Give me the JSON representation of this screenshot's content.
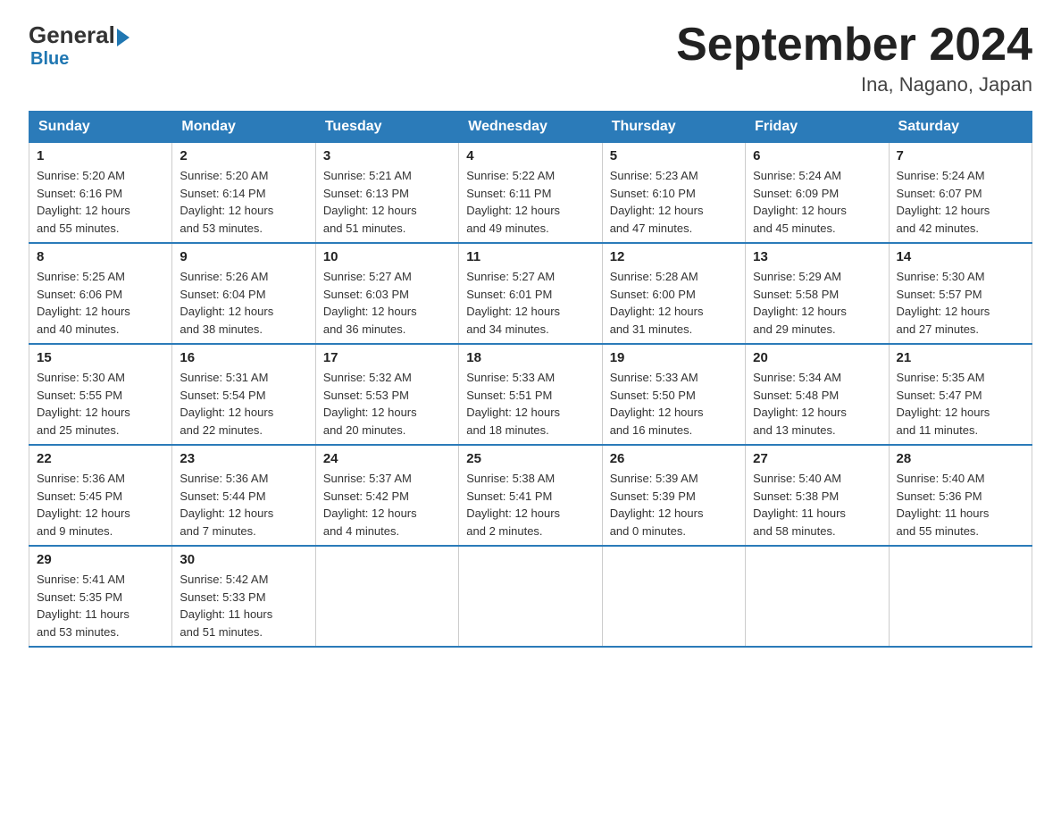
{
  "logo": {
    "general": "General",
    "blue": "Blue"
  },
  "header": {
    "month_year": "September 2024",
    "location": "Ina, Nagano, Japan"
  },
  "days_of_week": [
    "Sunday",
    "Monday",
    "Tuesday",
    "Wednesday",
    "Thursday",
    "Friday",
    "Saturday"
  ],
  "weeks": [
    [
      {
        "day": "1",
        "sunrise": "5:20 AM",
        "sunset": "6:16 PM",
        "daylight": "12 hours and 55 minutes."
      },
      {
        "day": "2",
        "sunrise": "5:20 AM",
        "sunset": "6:14 PM",
        "daylight": "12 hours and 53 minutes."
      },
      {
        "day": "3",
        "sunrise": "5:21 AM",
        "sunset": "6:13 PM",
        "daylight": "12 hours and 51 minutes."
      },
      {
        "day": "4",
        "sunrise": "5:22 AM",
        "sunset": "6:11 PM",
        "daylight": "12 hours and 49 minutes."
      },
      {
        "day": "5",
        "sunrise": "5:23 AM",
        "sunset": "6:10 PM",
        "daylight": "12 hours and 47 minutes."
      },
      {
        "day": "6",
        "sunrise": "5:24 AM",
        "sunset": "6:09 PM",
        "daylight": "12 hours and 45 minutes."
      },
      {
        "day": "7",
        "sunrise": "5:24 AM",
        "sunset": "6:07 PM",
        "daylight": "12 hours and 42 minutes."
      }
    ],
    [
      {
        "day": "8",
        "sunrise": "5:25 AM",
        "sunset": "6:06 PM",
        "daylight": "12 hours and 40 minutes."
      },
      {
        "day": "9",
        "sunrise": "5:26 AM",
        "sunset": "6:04 PM",
        "daylight": "12 hours and 38 minutes."
      },
      {
        "day": "10",
        "sunrise": "5:27 AM",
        "sunset": "6:03 PM",
        "daylight": "12 hours and 36 minutes."
      },
      {
        "day": "11",
        "sunrise": "5:27 AM",
        "sunset": "6:01 PM",
        "daylight": "12 hours and 34 minutes."
      },
      {
        "day": "12",
        "sunrise": "5:28 AM",
        "sunset": "6:00 PM",
        "daylight": "12 hours and 31 minutes."
      },
      {
        "day": "13",
        "sunrise": "5:29 AM",
        "sunset": "5:58 PM",
        "daylight": "12 hours and 29 minutes."
      },
      {
        "day": "14",
        "sunrise": "5:30 AM",
        "sunset": "5:57 PM",
        "daylight": "12 hours and 27 minutes."
      }
    ],
    [
      {
        "day": "15",
        "sunrise": "5:30 AM",
        "sunset": "5:55 PM",
        "daylight": "12 hours and 25 minutes."
      },
      {
        "day": "16",
        "sunrise": "5:31 AM",
        "sunset": "5:54 PM",
        "daylight": "12 hours and 22 minutes."
      },
      {
        "day": "17",
        "sunrise": "5:32 AM",
        "sunset": "5:53 PM",
        "daylight": "12 hours and 20 minutes."
      },
      {
        "day": "18",
        "sunrise": "5:33 AM",
        "sunset": "5:51 PM",
        "daylight": "12 hours and 18 minutes."
      },
      {
        "day": "19",
        "sunrise": "5:33 AM",
        "sunset": "5:50 PM",
        "daylight": "12 hours and 16 minutes."
      },
      {
        "day": "20",
        "sunrise": "5:34 AM",
        "sunset": "5:48 PM",
        "daylight": "12 hours and 13 minutes."
      },
      {
        "day": "21",
        "sunrise": "5:35 AM",
        "sunset": "5:47 PM",
        "daylight": "12 hours and 11 minutes."
      }
    ],
    [
      {
        "day": "22",
        "sunrise": "5:36 AM",
        "sunset": "5:45 PM",
        "daylight": "12 hours and 9 minutes."
      },
      {
        "day": "23",
        "sunrise": "5:36 AM",
        "sunset": "5:44 PM",
        "daylight": "12 hours and 7 minutes."
      },
      {
        "day": "24",
        "sunrise": "5:37 AM",
        "sunset": "5:42 PM",
        "daylight": "12 hours and 4 minutes."
      },
      {
        "day": "25",
        "sunrise": "5:38 AM",
        "sunset": "5:41 PM",
        "daylight": "12 hours and 2 minutes."
      },
      {
        "day": "26",
        "sunrise": "5:39 AM",
        "sunset": "5:39 PM",
        "daylight": "12 hours and 0 minutes."
      },
      {
        "day": "27",
        "sunrise": "5:40 AM",
        "sunset": "5:38 PM",
        "daylight": "11 hours and 58 minutes."
      },
      {
        "day": "28",
        "sunrise": "5:40 AM",
        "sunset": "5:36 PM",
        "daylight": "11 hours and 55 minutes."
      }
    ],
    [
      {
        "day": "29",
        "sunrise": "5:41 AM",
        "sunset": "5:35 PM",
        "daylight": "11 hours and 53 minutes."
      },
      {
        "day": "30",
        "sunrise": "5:42 AM",
        "sunset": "5:33 PM",
        "daylight": "11 hours and 51 minutes."
      },
      null,
      null,
      null,
      null,
      null
    ]
  ],
  "labels": {
    "sunrise_prefix": "Sunrise: ",
    "sunset_prefix": "Sunset: ",
    "daylight_prefix": "Daylight: "
  }
}
